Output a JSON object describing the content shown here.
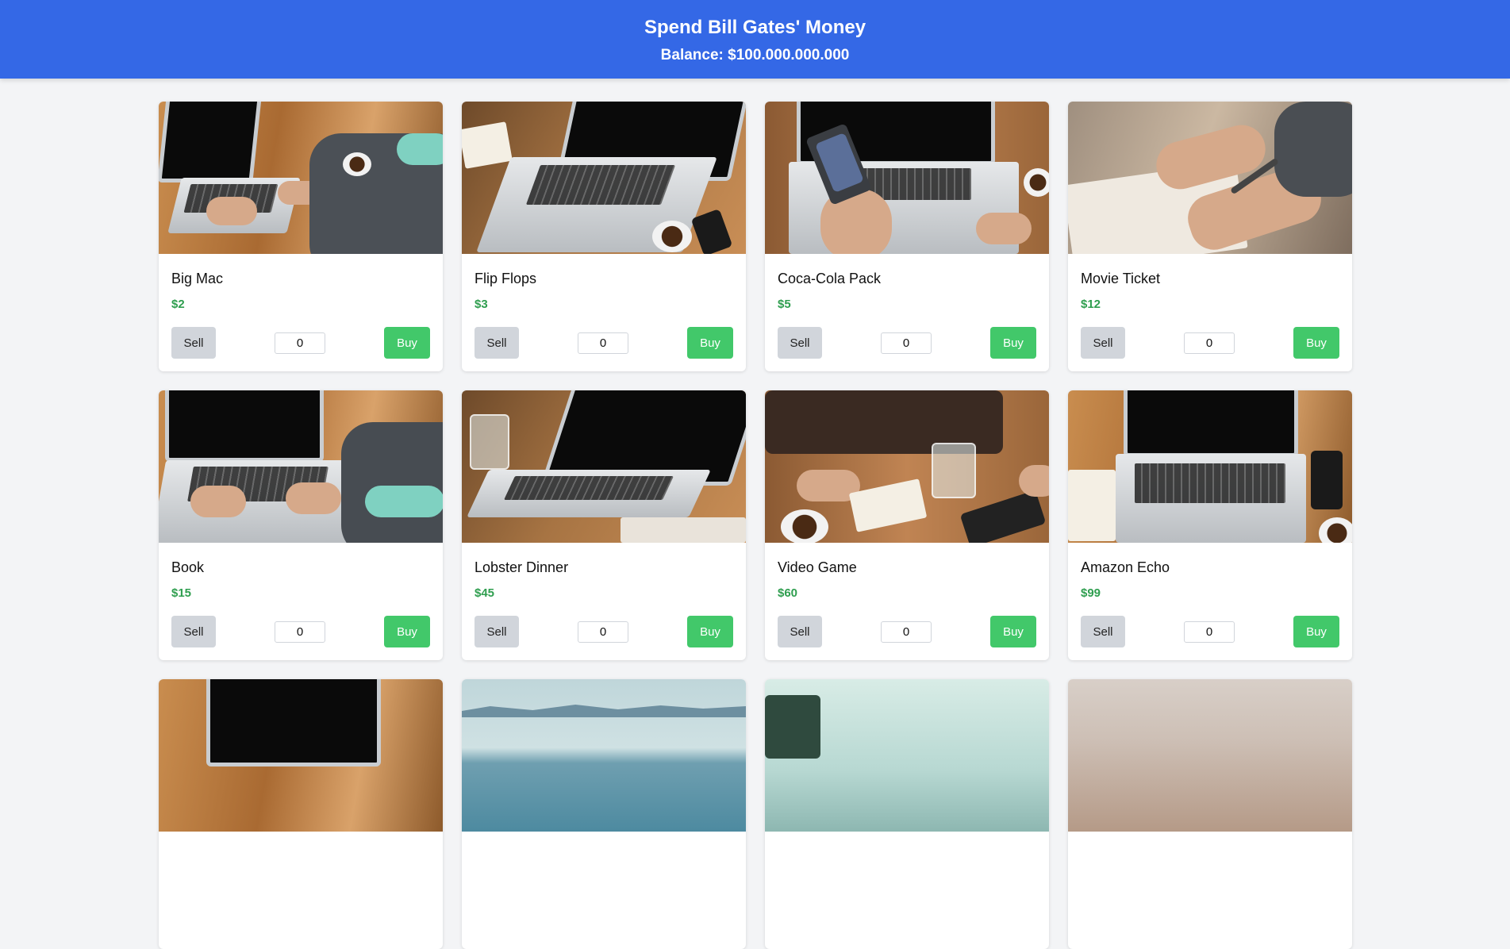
{
  "header": {
    "title": "Spend Bill Gates' Money",
    "balance": "Balance: $100.000.000.000"
  },
  "colors": {
    "header_bg": "#3468e6",
    "price": "#2f9e4f",
    "buy_button": "#42c86a",
    "sell_button": "#d1d5db"
  },
  "labels": {
    "sell": "Sell",
    "buy": "Buy"
  },
  "products": [
    {
      "name": "Big Mac",
      "price": "$2",
      "qty": "0"
    },
    {
      "name": "Flip Flops",
      "price": "$3",
      "qty": "0"
    },
    {
      "name": "Coca-Cola Pack",
      "price": "$5",
      "qty": "0"
    },
    {
      "name": "Movie Ticket",
      "price": "$12",
      "qty": "0"
    },
    {
      "name": "Book",
      "price": "$15",
      "qty": "0"
    },
    {
      "name": "Lobster Dinner",
      "price": "$45",
      "qty": "0"
    },
    {
      "name": "Video Game",
      "price": "$60",
      "qty": "0"
    },
    {
      "name": "Amazon Echo",
      "price": "$99",
      "qty": "0"
    }
  ]
}
